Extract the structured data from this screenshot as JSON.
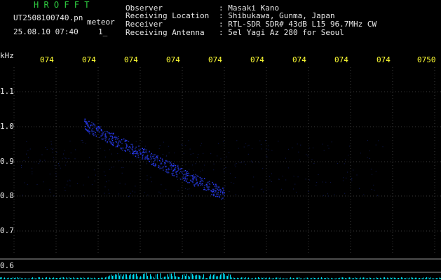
{
  "header": {
    "app_name": "H R O F F T",
    "filename": "UT2508100740.pn",
    "mode": "meteor",
    "datetime": "25.08.10 07:40",
    "marker": "1_"
  },
  "info": {
    "observer_label": "Observer",
    "observer_value": ": Masaki Kano",
    "location_label": "Receiving Location",
    "location_value": ": Shibukawa, Gunma, Japan",
    "receiver_label": "Receiver",
    "receiver_value": ": RTL-SDR SDR# 43dB L15 96.7MHz CW",
    "antenna_label": "Receiving Antenna",
    "antenna_value": ": 5el Yagi Az 280 for Seoul"
  },
  "time_axis": {
    "ticks": [
      "074",
      "074",
      "074",
      "074",
      "074",
      "074",
      "074",
      "074",
      "074",
      "0750"
    ]
  },
  "freq_axis": {
    "unit": "kHz",
    "ticks": [
      "1.1",
      "1.0",
      "0.9",
      "0.8",
      "0.7",
      "0.6"
    ]
  },
  "colors": {
    "background": "#000000",
    "title": "#2ecc40",
    "labels": "#e8e8e8",
    "ticks": "#ffff33",
    "signal": "#2a3cff",
    "level": "#00e5ff"
  }
}
